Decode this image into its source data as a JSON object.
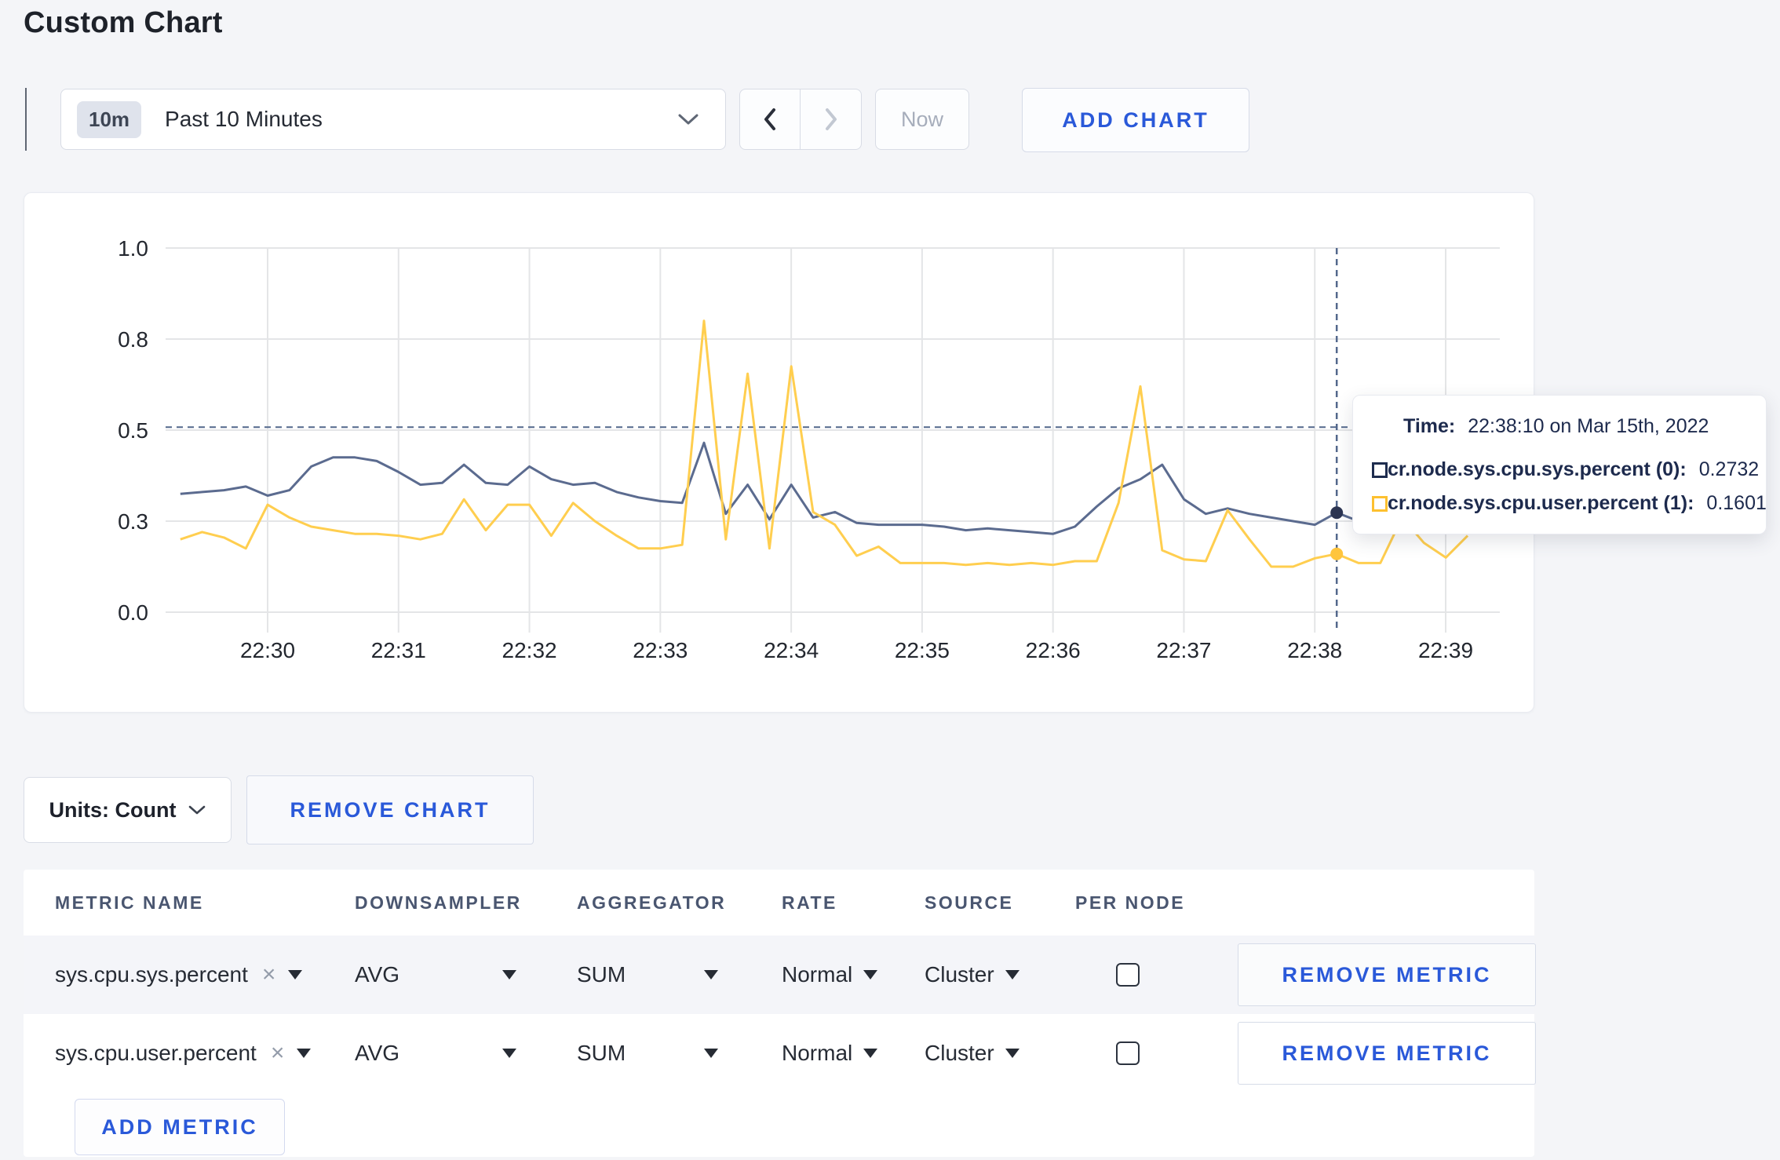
{
  "page": {
    "title": "Custom Chart"
  },
  "toolbar": {
    "range_badge": "10m",
    "range_label": "Past 10 Minutes",
    "now_label": "Now",
    "add_chart_label": "ADD CHART"
  },
  "chart_data": {
    "type": "line",
    "x_start": "22:29:20",
    "x_step_seconds": 10,
    "x_ticks": [
      "22:30",
      "22:31",
      "22:32",
      "22:33",
      "22:34",
      "22:35",
      "22:36",
      "22:37",
      "22:38",
      "22:39"
    ],
    "y_ticks": [
      {
        "label": "1.0",
        "v": 1.0
      },
      {
        "label": "0.8",
        "v": 0.75
      },
      {
        "label": "0.5",
        "v": 0.5
      },
      {
        "label": "0.3",
        "v": 0.25
      },
      {
        "label": "0.0",
        "v": 0.0
      }
    ],
    "ylim": [
      0,
      1
    ],
    "grid": true,
    "series": [
      {
        "name": "cr.node.sys.cpu.sys.percent (0)",
        "color": "#5b6b8f",
        "values": [
          0.325,
          0.33,
          0.335,
          0.345,
          0.32,
          0.335,
          0.4,
          0.425,
          0.425,
          0.415,
          0.385,
          0.35,
          0.355,
          0.405,
          0.355,
          0.35,
          0.4,
          0.365,
          0.35,
          0.355,
          0.33,
          0.315,
          0.305,
          0.3,
          0.465,
          0.27,
          0.35,
          0.255,
          0.35,
          0.26,
          0.275,
          0.245,
          0.24,
          0.24,
          0.24,
          0.235,
          0.225,
          0.23,
          0.225,
          0.22,
          0.215,
          0.235,
          0.29,
          0.34,
          0.365,
          0.405,
          0.31,
          0.27,
          0.285,
          0.27,
          0.26,
          0.25,
          0.24,
          0.2732,
          0.25,
          0.265,
          0.275,
          0.27,
          0.275,
          0.28
        ]
      },
      {
        "name": "cr.node.sys.cpu.user.percent (1)",
        "color": "#ffce4f",
        "values": [
          0.2,
          0.22,
          0.205,
          0.175,
          0.295,
          0.26,
          0.235,
          0.225,
          0.215,
          0.215,
          0.21,
          0.2,
          0.215,
          0.31,
          0.225,
          0.295,
          0.295,
          0.21,
          0.3,
          0.25,
          0.21,
          0.175,
          0.175,
          0.185,
          0.8,
          0.2,
          0.655,
          0.175,
          0.675,
          0.275,
          0.24,
          0.155,
          0.18,
          0.135,
          0.135,
          0.135,
          0.13,
          0.135,
          0.13,
          0.135,
          0.13,
          0.14,
          0.14,
          0.3,
          0.62,
          0.17,
          0.145,
          0.14,
          0.28,
          0.2,
          0.125,
          0.125,
          0.148,
          0.1601,
          0.135,
          0.135,
          0.26,
          0.19,
          0.15,
          0.21
        ]
      }
    ],
    "hover": {
      "index": 53,
      "hline_value": 0.508,
      "time_label": "Time:",
      "time_value": "22:38:10 on Mar 15th, 2022",
      "rows": [
        {
          "label": "cr.node.sys.cpu.sys.percent (0):",
          "value": "0.2732",
          "swatch": "#1e2c4e"
        },
        {
          "label": "cr.node.sys.cpu.user.percent (1):",
          "value": "0.1601",
          "swatch": "#fdc02f"
        }
      ]
    },
    "colors": {
      "grid": "#e4e5e7",
      "crosshair": "#53688c",
      "axis_text": "#23272f"
    }
  },
  "chart_footer": {
    "units_label": "Units: Count",
    "remove_chart_label": "REMOVE CHART"
  },
  "metrics_table": {
    "headers": [
      "METRIC NAME",
      "DOWNSAMPLER",
      "AGGREGATOR",
      "RATE",
      "SOURCE",
      "PER NODE"
    ],
    "rows": [
      {
        "metric": "sys.cpu.sys.percent",
        "downsampler": "AVG",
        "aggregator": "SUM",
        "rate": "Normal",
        "source": "Cluster",
        "per_node": false,
        "remove_label": "REMOVE METRIC"
      },
      {
        "metric": "sys.cpu.user.percent",
        "downsampler": "AVG",
        "aggregator": "SUM",
        "rate": "Normal",
        "source": "Cluster",
        "per_node": false,
        "remove_label": "REMOVE METRIC"
      }
    ],
    "add_metric_label": "ADD METRIC"
  }
}
